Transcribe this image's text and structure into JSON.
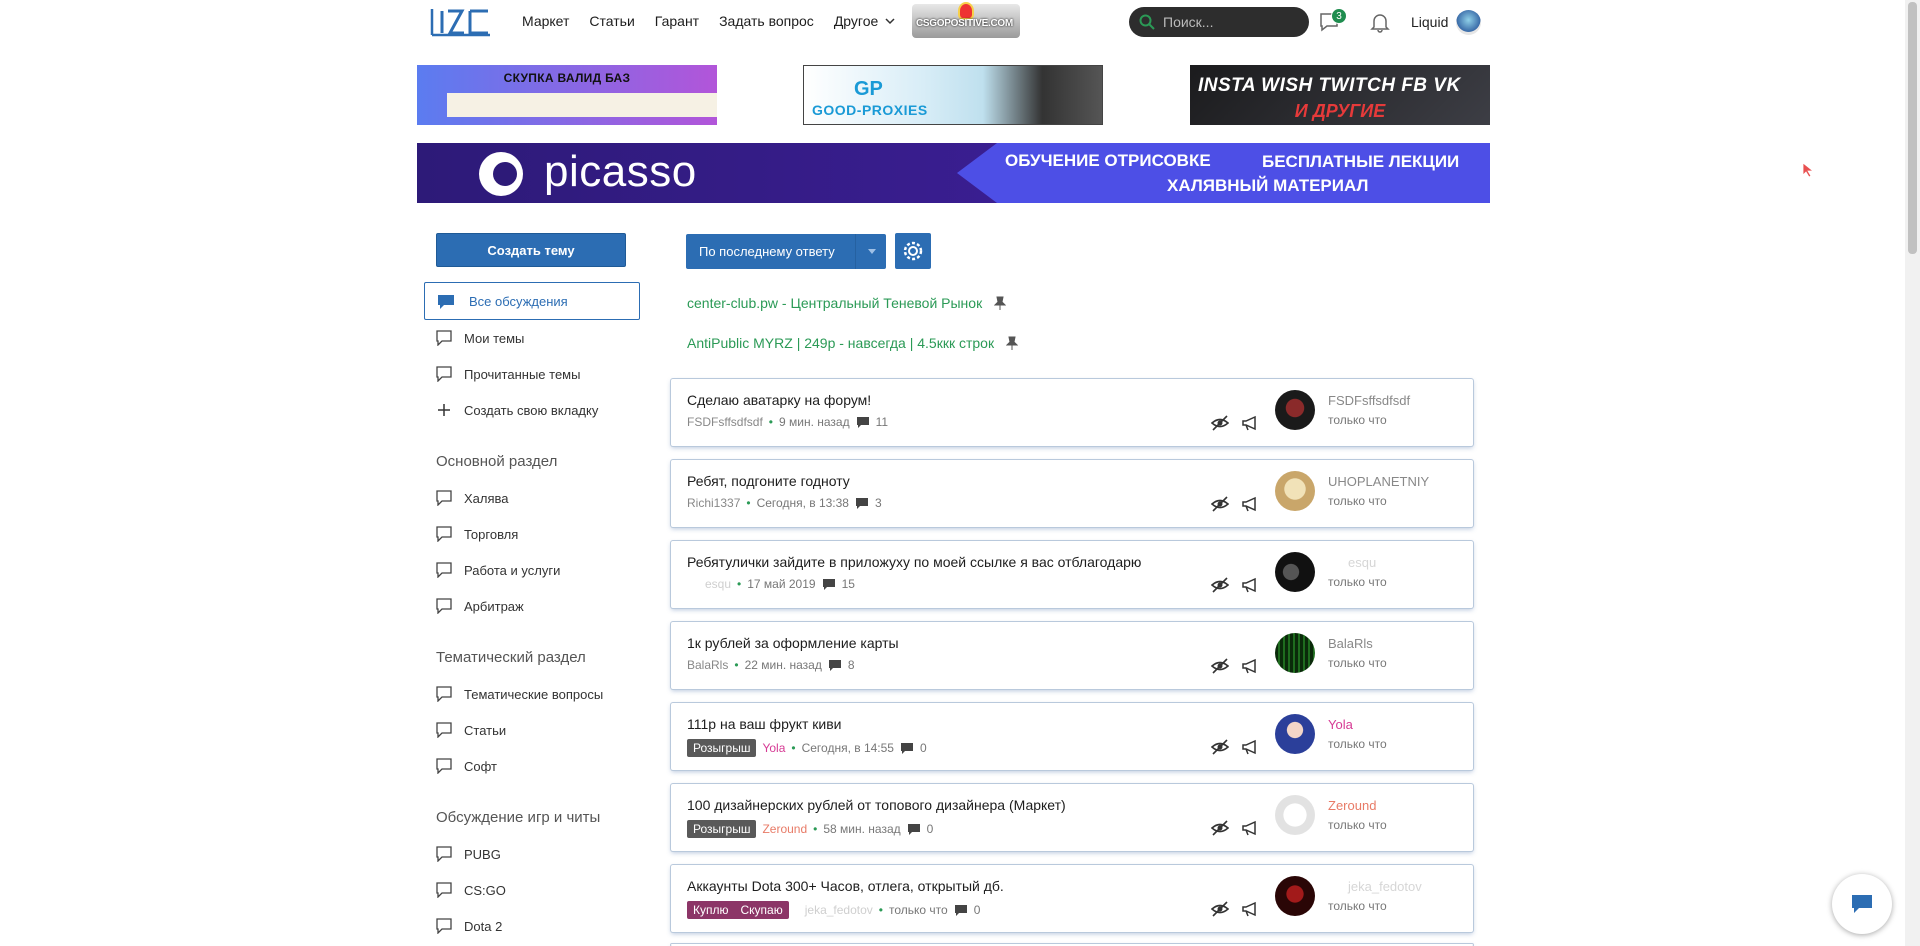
{
  "header": {
    "nav": [
      "Маркет",
      "Статьи",
      "Гарант",
      "Задать вопрос",
      "Другое"
    ],
    "mini_ad_text": "CSGOPOSITIVE.COM",
    "search_placeholder": "Поиск...",
    "messages_badge": "3",
    "username": "Liquid"
  },
  "banners": {
    "b1_text": "СКУПКА ВАЛИД БАЗ",
    "b2_logo": "GP",
    "b2_text": "GOOD-PROXIES",
    "b3_line1": "INSTA  WISH  TWITCH  FB  VK",
    "b3_line2": "И ДРУГИЕ",
    "picasso_name": "picasso",
    "picasso_t1": "ОБУЧЕНИЕ ОТРИСОВКЕ",
    "picasso_t2": "БЕСПЛАТНЫЕ ЛЕКЦИИ",
    "picasso_t3": "ХАЛЯВНЫЙ МАТЕРИАЛ"
  },
  "sidebar": {
    "create_label": "Создать тему",
    "active_item": "Все обсуждения",
    "items": [
      "Мои темы",
      "Прочитанные темы",
      "Создать свою вкладку"
    ],
    "section1": "Основной раздел",
    "section1_items": [
      "Халява",
      "Торговля",
      "Работа и услуги",
      "Арбитраж"
    ],
    "section2": "Тематический раздел",
    "section2_items": [
      "Тематические вопросы",
      "Статьи",
      "Софт"
    ],
    "section3": "Обсуждение игр и читы",
    "section3_items": [
      "PUBG",
      "CS:GO",
      "Dota 2"
    ]
  },
  "main": {
    "sort_label": "По последнему ответу",
    "sticky": [
      "center-club.pw - Центральный Теневой Рынок",
      "AntiPublic MYRZ | 249р - навсегда | 4.5ккк строк"
    ],
    "threads": [
      {
        "title": "Сделаю аватарку на форум!",
        "author": "FSDFsffsdfsdf",
        "time": "9 мин. назад",
        "replies": "11",
        "last_user": "FSDFsffsdfsdf",
        "last_time": "только что",
        "tags": []
      },
      {
        "title": "Ребят, подгоните годноту",
        "author": "Richi1337",
        "time": "Сегодня, в 13:38",
        "replies": "3",
        "last_user": "UHOPLANETNIY",
        "last_time": "только что",
        "tags": []
      },
      {
        "title": "Ребятулички зайдите в приложуху по моей ссылке я вас отблагодарю",
        "author": "esqu",
        "time": "17 май 2019",
        "replies": "15",
        "last_user": "esqu",
        "last_time": "только что",
        "tags": []
      },
      {
        "title": "1к рублей за оформление карты",
        "author": "BalaRls",
        "time": "22 мин. назад",
        "replies": "8",
        "last_user": "BalaRls",
        "last_time": "только что",
        "tags": []
      },
      {
        "title": "111р на ваш фрукт киви",
        "author": "Yola",
        "time": "Сегодня, в 14:55",
        "replies": "0",
        "last_user": "Yola",
        "last_time": "только что",
        "tags": [
          "Розыгрыш"
        ]
      },
      {
        "title": "100 дизайнерских рублей от топового дизайнера (Маркет)",
        "author": "Zeround",
        "time": "58 мин. назад",
        "replies": "0",
        "last_user": "Zeround",
        "last_time": "только что",
        "tags": [
          "Розыгрыш"
        ]
      },
      {
        "title": "Аккаунты Dota 300+ Часов, отлега, открытый дб.",
        "author": "jeka_fedotov",
        "time": "только что",
        "replies": "0",
        "last_user": "jeka_fedotov",
        "last_time": "только что",
        "tags": [
          "Куплю",
          "Скупаю"
        ]
      }
    ]
  },
  "colors": {
    "accent": "#2c6db3",
    "sticky_green": "#2b9a56",
    "tag_gray": "#595959",
    "tag_purple": "#8c3567"
  }
}
